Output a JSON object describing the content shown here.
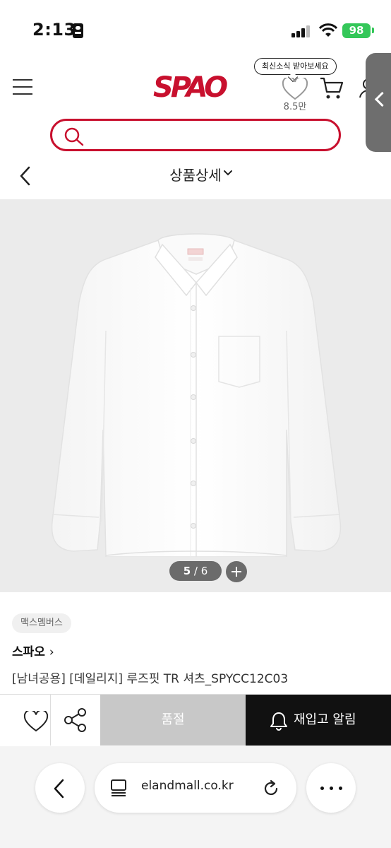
{
  "status_bar": {
    "time": "2:13",
    "battery": "98"
  },
  "header": {
    "logo": "SPAO",
    "notice_tooltip": "최신소식 받아보세요",
    "wish_count": "8.5만"
  },
  "search": {
    "placeholder": ""
  },
  "nav": {
    "title": "상품상세"
  },
  "gallery": {
    "current": "5",
    "total": "6",
    "separator": " / "
  },
  "product": {
    "tag": "맥스멤버스",
    "brand": "스파오",
    "brand_arrow": "›",
    "name": "[남녀공용] [데일리지] 루즈핏 TR 셔츠_SPYCC12C03"
  },
  "actions": {
    "soldout_label": "품절",
    "restock_label": "재입고 알림"
  },
  "browser": {
    "url": "elandmall.co.kr"
  },
  "colors": {
    "brand_red": "#c8102e",
    "soldout_gray": "#c8c8c8",
    "restock_black": "#111111"
  }
}
